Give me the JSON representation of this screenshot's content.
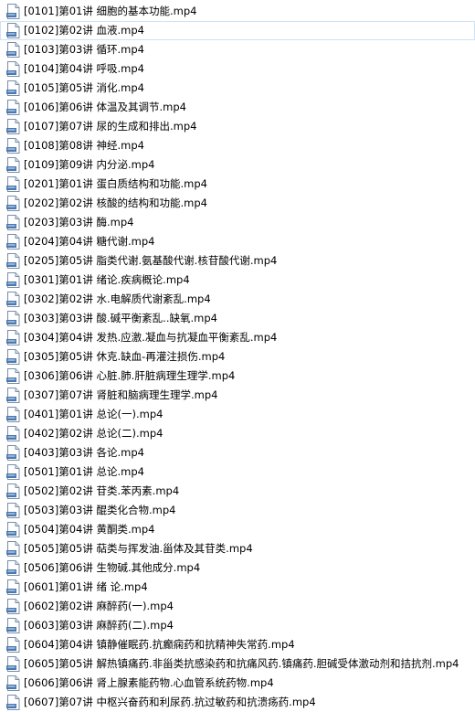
{
  "files": [
    {
      "name": "[0101]第01讲 细胞的基本功能.mp4",
      "icon": "mp4-file-icon"
    },
    {
      "name": "[0102]第02讲 血液.mp4",
      "icon": "mp4-file-icon",
      "selected": true
    },
    {
      "name": "[0103]第03讲 循环.mp4",
      "icon": "mp4-file-icon"
    },
    {
      "name": "[0104]第04讲 呼吸.mp4",
      "icon": "mp4-file-icon"
    },
    {
      "name": "[0105]第05讲 消化.mp4",
      "icon": "mp4-file-icon"
    },
    {
      "name": "[0106]第06讲 体温及其调节.mp4",
      "icon": "mp4-file-icon"
    },
    {
      "name": "[0107]第07讲 尿的生成和排出.mp4",
      "icon": "mp4-file-icon"
    },
    {
      "name": "[0108]第08讲 神经.mp4",
      "icon": "mp4-file-icon"
    },
    {
      "name": "[0109]第09讲 内分泌.mp4",
      "icon": "mp4-file-icon"
    },
    {
      "name": "[0201]第01讲 蛋白质结构和功能.mp4",
      "icon": "mp4-file-icon"
    },
    {
      "name": "[0202]第02讲 核酸的结构和功能.mp4",
      "icon": "mp4-file-icon"
    },
    {
      "name": "[0203]第03讲 酶.mp4",
      "icon": "mp4-file-icon"
    },
    {
      "name": "[0204]第04讲 糖代谢.mp4",
      "icon": "mp4-file-icon"
    },
    {
      "name": "[0205]第05讲 脂类代谢.氨基酸代谢.核苷酸代谢.mp4",
      "icon": "mp4-file-icon"
    },
    {
      "name": "[0301]第01讲 绪论.疾病概论.mp4",
      "icon": "mp4-file-icon"
    },
    {
      "name": "[0302]第02讲 水.电解质代谢紊乱.mp4",
      "icon": "mp4-file-icon"
    },
    {
      "name": "[0303]第03讲 酸.碱平衡紊乱..缺氧.mp4",
      "icon": "mp4-file-icon"
    },
    {
      "name": "[0304]第04讲 发热.应激.凝血与抗凝血平衡紊乱.mp4",
      "icon": "mp4-file-icon"
    },
    {
      "name": "[0305]第05讲 休克.缺血-再灌注损伤.mp4",
      "icon": "mp4-file-icon"
    },
    {
      "name": "[0306]第06讲 心脏.肺.肝脏病理生理学.mp4",
      "icon": "mp4-file-icon"
    },
    {
      "name": "[0307]第07讲 肾脏和脑病理生理学.mp4",
      "icon": "mp4-file-icon"
    },
    {
      "name": "[0401]第01讲 总论(一).mp4",
      "icon": "mp4-file-icon"
    },
    {
      "name": "[0402]第02讲 总论(二).mp4",
      "icon": "mp4-file-icon"
    },
    {
      "name": "[0403]第03讲 各论.mp4",
      "icon": "mp4-file-icon"
    },
    {
      "name": "[0501]第01讲 总论.mp4",
      "icon": "mp4-file-icon"
    },
    {
      "name": "[0502]第02讲 苷类.苯丙素.mp4",
      "icon": "mp4-file-icon"
    },
    {
      "name": "[0503]第03讲 醌类化合物.mp4",
      "icon": "mp4-file-icon"
    },
    {
      "name": "[0504]第04讲 黄酮类.mp4",
      "icon": "mp4-file-icon"
    },
    {
      "name": "[0505]第05讲 萜类与挥发油.甾体及其苷类.mp4",
      "icon": "mp4-file-icon"
    },
    {
      "name": "[0506]第06讲 生物碱.其他成分.mp4",
      "icon": "mp4-file-icon"
    },
    {
      "name": "[0601]第01讲 绪 论.mp4",
      "icon": "mp4-file-icon"
    },
    {
      "name": "[0602]第02讲 麻醉药(一).mp4",
      "icon": "mp4-file-icon"
    },
    {
      "name": "[0603]第03讲 麻醉药(二).mp4",
      "icon": "mp4-file-icon"
    },
    {
      "name": "[0604]第04讲 镇静催眠药.抗癫痫药和抗精神失常药.mp4",
      "icon": "mp4-file-icon"
    },
    {
      "name": "[0605]第05讲 解热镇痛药.非甾类抗感染药和抗痛风药.镇痛药.胆碱受体激动剂和拮抗剂.mp4",
      "icon": "mp4-file-icon"
    },
    {
      "name": "[0606]第06讲 肾上腺素能药物.心血管系统药物.mp4",
      "icon": "mp4-file-icon"
    },
    {
      "name": "[0607]第07讲 中枢兴奋药和利尿药.抗过敏药和抗溃疡药.mp4",
      "icon": "mp4-file-icon"
    }
  ],
  "colors": {
    "icon_page": "#ffffff",
    "icon_border": "#7a8ea8",
    "icon_band": "#4a78b0",
    "icon_fold": "#d8e2ee",
    "selected_outline": "#cfe3f7"
  }
}
